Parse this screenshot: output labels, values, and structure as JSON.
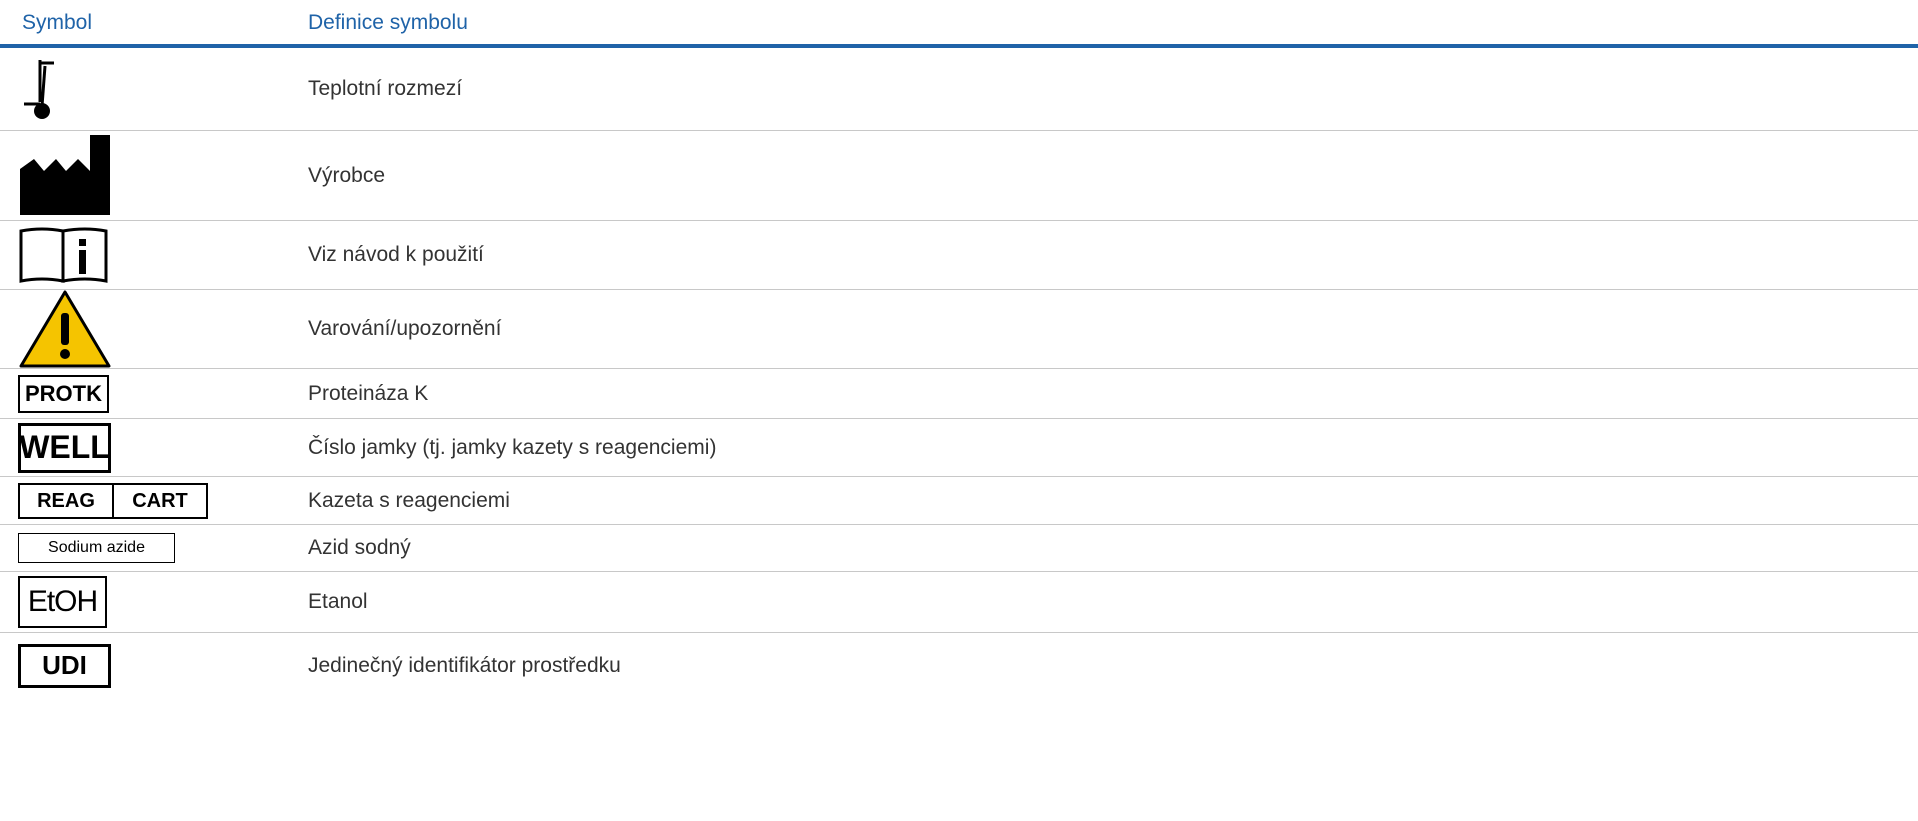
{
  "header": {
    "symbol": "Symbol",
    "definition": "Definice symbolu"
  },
  "rows": [
    {
      "icon": "temperature-limit-icon",
      "definition": "Teplotní rozmezí"
    },
    {
      "icon": "manufacturer-icon",
      "definition": "Výrobce"
    },
    {
      "icon": "instructions-for-use-icon",
      "definition": "Viz návod k použití"
    },
    {
      "icon": "warning-icon",
      "definition": "Varování/upozornění"
    },
    {
      "icon": "protk-label-icon",
      "label": "PROTK",
      "definition": "Proteináza K"
    },
    {
      "icon": "well-label-icon",
      "label": "WELL",
      "definition": "Číslo jamky (tj. jamky kazety s reagenciemi)"
    },
    {
      "icon": "reag-cart-label-icon",
      "label_left": "REAG",
      "label_right": "CART",
      "definition": "Kazeta s reagenciemi"
    },
    {
      "icon": "sodium-azide-label-icon",
      "label": "Sodium azide",
      "definition": "Azid sodný"
    },
    {
      "icon": "etoh-label-icon",
      "label": "EtOH",
      "definition": "Etanol"
    },
    {
      "icon": "udi-label-icon",
      "label": "UDI",
      "definition": "Jedinečný identifikátor prostředku"
    }
  ],
  "colors": {
    "accent": "#1f63a8",
    "text": "#333333",
    "warning_yellow": "#f5c400",
    "rule": "#c8c8c8"
  }
}
